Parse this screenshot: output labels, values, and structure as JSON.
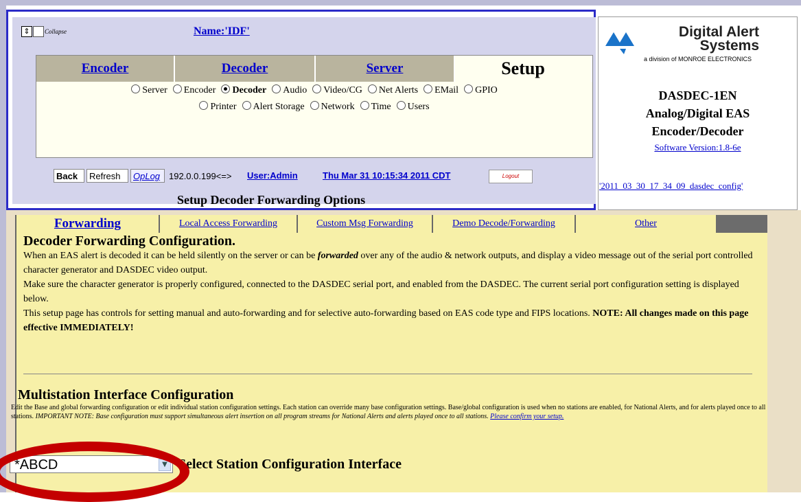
{
  "header": {
    "collapse_label": "Collapse",
    "name_link": "Name:'IDF'"
  },
  "main_tabs": [
    {
      "label": "Encoder"
    },
    {
      "label": "Decoder"
    },
    {
      "label": "Server"
    },
    {
      "label": "Setup"
    }
  ],
  "setup_options_row1": [
    "Server",
    "Encoder",
    "Decoder",
    "Audio",
    "Video/CG",
    "Net Alerts",
    "EMail",
    "GPIO"
  ],
  "setup_options_row2": [
    "Printer",
    "Alert Storage",
    "Network",
    "Time",
    "Users"
  ],
  "selected_option": "Decoder",
  "toolbar": {
    "back_label": "Back",
    "refresh_label": "Refresh",
    "oplog_label": "OpLog",
    "ip_text": "192.0.0.199<=>",
    "user_link": "User:Admin",
    "datetime_link": "Thu Mar 31 10:15:34 2011 CDT",
    "logout_label": "Logout"
  },
  "page_title": "Setup Decoder Forwarding Options",
  "logo": {
    "company": "Digital Alert Systems",
    "company_line1": "Digital Alert",
    "company_line2": "Systems",
    "division": "a division of MONROE ELECTRONICS",
    "product_line1": "DASDEC-1EN",
    "product_line2": "Analog/Digital EAS",
    "product_line3": "Encoder/Decoder",
    "software_version": "Software Version:1.8-6e",
    "config_link": "'2011_03_30_17_34_09_dasdec_config'"
  },
  "sub_tabs": [
    {
      "label": "Forwarding"
    },
    {
      "label": "Local Access Forwarding"
    },
    {
      "label": "Custom Msg Forwarding"
    },
    {
      "label": "Demo Decode/Forwarding"
    },
    {
      "label": "Other"
    }
  ],
  "forwarding": {
    "heading": "Decoder Forwarding Configuration.",
    "p1_a": "When an EAS alert is decoded it can be held silently on the server or can be ",
    "p1_em": "forwarded",
    "p1_b": " over any of the audio & network outputs, and display a video message out of the serial port controlled character generator and DASDEC video output.",
    "p2": "Make sure the character generator is properly configured, connected to the DASDEC serial port, and enabled from the DASDEC. The current serial port configuration setting is displayed below.",
    "p3_a": "This setup page has controls for setting manual and auto-forwarding and for selective auto-forwarding based on EAS code type and FIPS locations. ",
    "p3_note": "NOTE: All changes made on this page effective IMMEDIATELY!"
  },
  "multistation": {
    "heading": "Multistation Interface Configuration",
    "text_normal": "Edit the Base and global forwarding configuration or edit individual station configuration settings. Each station can override many base configuration settings. Base/global configuration is used when no stations are enabled, for National Alerts, and for alerts played once to all stations. ",
    "text_italic": "IMPORTANT NOTE: Base configuration must support simultaneous alert insertion on all program streams for National Alerts and alerts played once to all stations. ",
    "confirm_link": "Please confirm your setup."
  },
  "station_select": {
    "value": "*ABCD",
    "label": "Select Station Configuration Interface"
  },
  "colors": {
    "link": "#0000cc",
    "tab_bg": "#b9b49e",
    "content_bg": "#f7f0a8",
    "highlight_oval": "#c40000",
    "logo_blue": "#1a73c9"
  }
}
